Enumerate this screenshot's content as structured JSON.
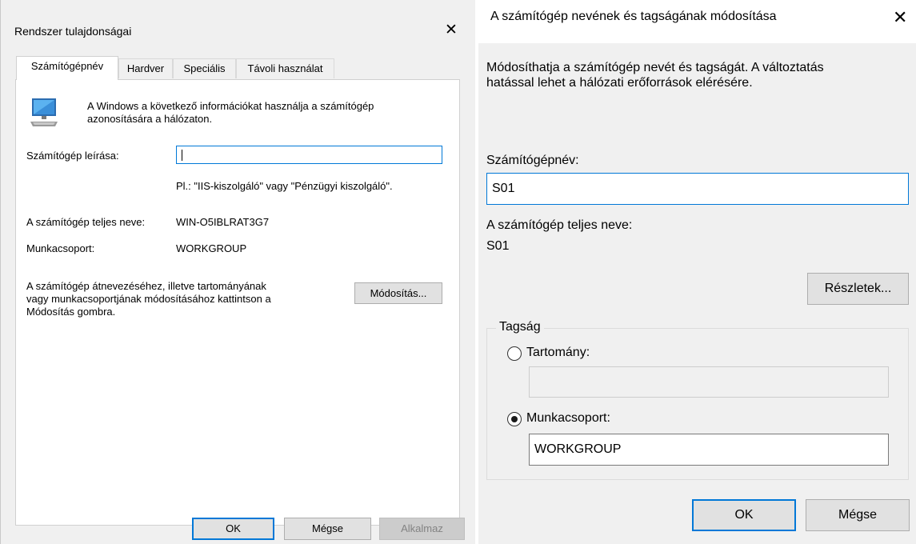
{
  "left_dialog": {
    "title": "Rendszer tulajdonságai",
    "close_glyph": "✕",
    "tabs": [
      {
        "label": "Számítógépnév",
        "active": true
      },
      {
        "label": "Hardver",
        "active": false
      },
      {
        "label": "Speciális",
        "active": false
      },
      {
        "label": "Távoli használat",
        "active": false
      }
    ],
    "icon": "computer-monitor-icon",
    "intro_line1": "A Windows a következő információkat használja a számítógép",
    "intro_line2": "azonosítására a hálózaton.",
    "description_label": "Számítógép leírása:",
    "description_value": "",
    "example_text": "Pl.: \"IIS-kiszolgáló\" vagy \"Pénzügyi kiszolgáló\".",
    "full_name_label": "A számítógép teljes neve:",
    "full_name_value": "WIN-O5IBLRAT3G7",
    "workgroup_label": "Munkacsoport:",
    "workgroup_value": "WORKGROUP",
    "rename_line1": "A számítógép átnevezéséhez, illetve tartományának",
    "rename_line2": "vagy munkacsoportjának módosításához kattintson a",
    "rename_line3": "Módosítás gombra.",
    "change_button": "Módosítás...",
    "ok_button": "OK",
    "cancel_button": "Mégse",
    "apply_button": "Alkalmaz"
  },
  "right_dialog": {
    "title": "A számítógép nevének és tagságának módosítása",
    "close_glyph": "✕",
    "intro_line1": "Módosíthatja a számítógép nevét és tagságát. A változtatás",
    "intro_line2": "hatással lehet a hálózati erőforrások elérésére.",
    "computer_name_label": "Számítógépnév:",
    "computer_name_value": "S01",
    "full_name_label": "A számítógép teljes neve:",
    "full_name_value": "S01",
    "details_button": "Részletek...",
    "membership_legend": "Tagság",
    "domain_label": "Tartomány:",
    "domain_value": "",
    "domain_selected": false,
    "workgroup_label": "Munkacsoport:",
    "workgroup_value": "WORKGROUP",
    "workgroup_selected": true,
    "ok_button": "OK",
    "cancel_button": "Mégse"
  },
  "colors": {
    "accent": "#0078d7",
    "dialog_bg": "#f0f0f0",
    "panel_bg": "#ffffff"
  }
}
